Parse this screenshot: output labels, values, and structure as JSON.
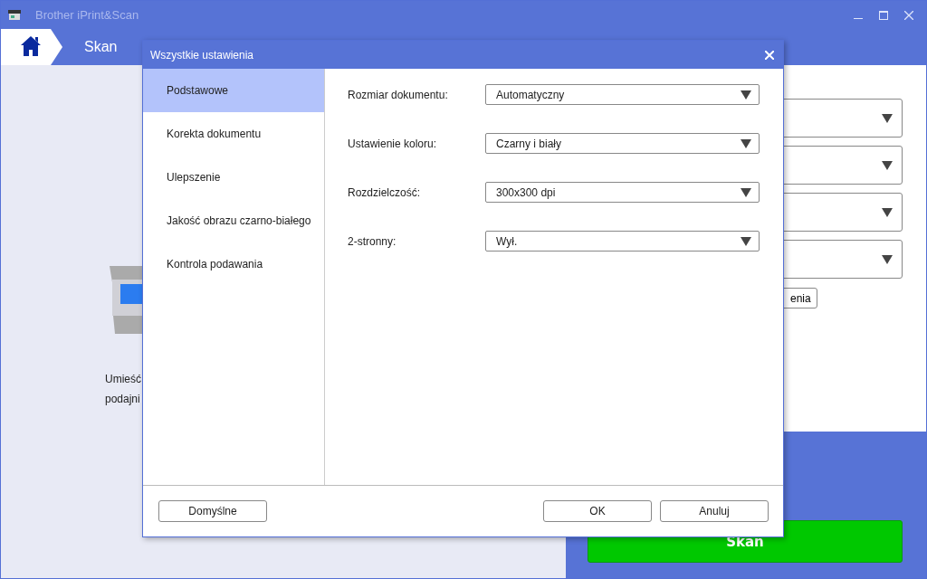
{
  "window": {
    "title": "Brother iPrint&Scan"
  },
  "breadcrumb": {
    "current": "Skan"
  },
  "left_panel": {
    "message_lines": [
      "Umieść",
      "podajni"
    ]
  },
  "right_panel": {
    "dropdowns": [
      {
        "kind": "dropdown"
      },
      {
        "kind": "dropdown"
      },
      {
        "kind": "dropdown"
      },
      {
        "kind": "dropdown"
      }
    ],
    "button": "enia",
    "scan_button": "Skan"
  },
  "dialog": {
    "title": "Wszystkie ustawienia",
    "categories": [
      {
        "label": "Podstawowe",
        "selected": true
      },
      {
        "label": "Korekta dokumentu",
        "selected": false
      },
      {
        "label": "Ulepszenie",
        "selected": false
      },
      {
        "label": "Jakość obrazu czarno-białego",
        "selected": false
      },
      {
        "label": "Kontrola podawania",
        "selected": false
      }
    ],
    "settings": [
      {
        "label": "Rozmiar dokumentu:",
        "value": "Automatyczny"
      },
      {
        "label": "Ustawienie koloru:",
        "value": "Czarny i biały"
      },
      {
        "label": "Rozdzielczość:",
        "value": "300x300 dpi"
      },
      {
        "label": "2-stronny:",
        "value": "Wył."
      }
    ],
    "default_button": "Domyślne",
    "ok_button": "OK",
    "cancel_button": "Anuluj"
  }
}
